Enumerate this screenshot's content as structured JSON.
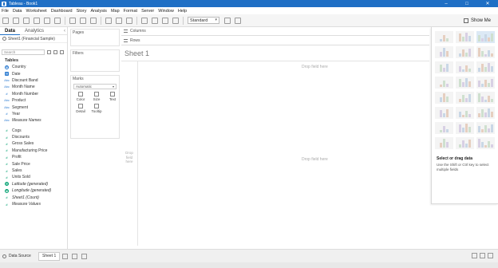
{
  "window": {
    "title": "Tableau - Book1",
    "controls": [
      "–",
      "□",
      "✕"
    ]
  },
  "menu": [
    "File",
    "Data",
    "Worksheet",
    "Dashboard",
    "Story",
    "Analysis",
    "Map",
    "Format",
    "Server",
    "Window",
    "Help"
  ],
  "toolbar": {
    "fit_label": "Standard",
    "show_me_label": "Show Me"
  },
  "data_pane": {
    "tabs": [
      "Data",
      "Analytics"
    ],
    "source": "Sheet1 (Financial Sample)",
    "search_placeholder": "Search",
    "tables_heading": "Tables",
    "dimensions": [
      {
        "icon": "globe",
        "glyph": "⊕",
        "label": "Country"
      },
      {
        "icon": "date",
        "glyph": "▦",
        "label": "Date"
      },
      {
        "icon": "abc",
        "glyph": "Abc",
        "label": "Discount Band"
      },
      {
        "icon": "abc",
        "glyph": "Abc",
        "label": "Month Name"
      },
      {
        "icon": "num",
        "glyph": "#",
        "label": "Month Number"
      },
      {
        "icon": "abc",
        "glyph": "Abc",
        "label": "Product"
      },
      {
        "icon": "abc",
        "glyph": "Abc",
        "label": "Segment"
      },
      {
        "icon": "num",
        "glyph": "#",
        "label": "Year"
      },
      {
        "icon": "abc",
        "glyph": "Abc",
        "label": "Measure Names",
        "italic": true
      }
    ],
    "measures": [
      {
        "icon": "num",
        "glyph": "#",
        "label": "Cogs"
      },
      {
        "icon": "num",
        "glyph": "#",
        "label": "Discounts"
      },
      {
        "icon": "num",
        "glyph": "#",
        "label": "Gross Sales"
      },
      {
        "icon": "num",
        "glyph": "#",
        "label": "Manufacturing Price"
      },
      {
        "icon": "num",
        "glyph": "#",
        "label": "Profit"
      },
      {
        "icon": "num",
        "glyph": "#",
        "label": "Sale Price"
      },
      {
        "icon": "num",
        "glyph": "#",
        "label": "Sales"
      },
      {
        "icon": "num",
        "glyph": "#",
        "label": "Units Sold"
      },
      {
        "icon": "geo",
        "glyph": "⊕",
        "label": "Latitude (generated)",
        "italic": true
      },
      {
        "icon": "geo",
        "glyph": "⊕",
        "label": "Longitude (generated)",
        "italic": true
      },
      {
        "icon": "num",
        "glyph": "#",
        "label": "Sheet1 (Count)",
        "italic": true
      },
      {
        "icon": "num",
        "glyph": "#",
        "label": "Measure Values",
        "italic": true
      }
    ]
  },
  "cards": {
    "pages": "Pages",
    "filters": "Filters",
    "marks": "Marks",
    "mark_type": "Automatic",
    "mark_buttons": [
      "Color",
      "Size",
      "Text",
      "Detail",
      "Tooltip"
    ]
  },
  "shelves": {
    "columns": "Columns",
    "rows": "Rows"
  },
  "view": {
    "sheet_title": "Sheet 1",
    "drop_top": "Drop field here",
    "drop_center": "Drop field here",
    "drop_left": "Drop field here"
  },
  "show_me": {
    "heading": "Select or drag data",
    "sub": "Use the Shift or Ctrl key to select multiple fields"
  },
  "status": {
    "data_source_label": "Data Source",
    "sheet_tab": "Sheet 1"
  },
  "colors": {
    "title_bar": "#1f6fc5",
    "dimension": "#2b7bd1",
    "measure": "#00a070"
  }
}
